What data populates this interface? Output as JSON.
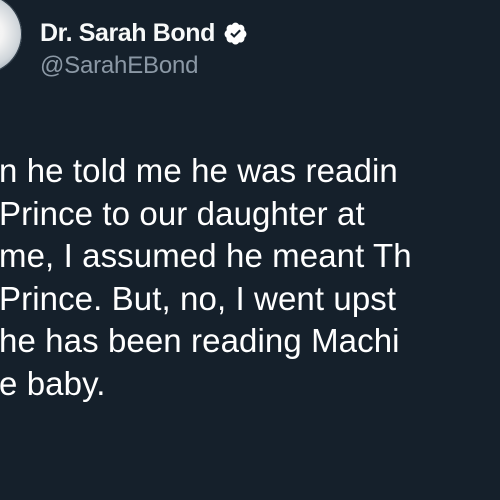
{
  "profile": {
    "display_name": "Dr. Sarah Bond",
    "handle": "@SarahEBond",
    "verified_icon": "verified-check-icon",
    "verified_color": "#ffffff"
  },
  "tweet": {
    "lines": [
      "n he told me he was readin",
      "Prince to our daughter at",
      "me, I assumed he meant Th",
      "Prince. But, no, I went upst",
      "he has been reading Machi",
      "e baby."
    ]
  },
  "colors": {
    "background": "#15202b",
    "text_primary": "#ffffff",
    "text_secondary": "#8b98a5"
  }
}
